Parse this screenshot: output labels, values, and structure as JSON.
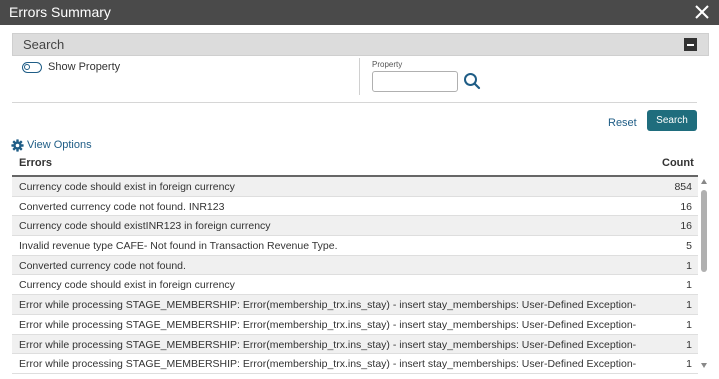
{
  "window": {
    "title": "Errors Summary"
  },
  "search_panel": {
    "label": "Search"
  },
  "filters": {
    "toggle_label": "Show Property",
    "property_label": "Property",
    "property_value": ""
  },
  "actions": {
    "reset_label": "Reset",
    "search_label": "Search"
  },
  "view_options": {
    "label": "View Options"
  },
  "table": {
    "headers": {
      "errors": "Errors",
      "count": "Count"
    },
    "rows": [
      {
        "error": "Currency code should exist          in foreign currency",
        "count": "854"
      },
      {
        "error": "Converted currency code not found. INR123",
        "count": "16"
      },
      {
        "error": "Currency code should existINR123 in foreign currency",
        "count": "16"
      },
      {
        "error": "Invalid revenue type CAFE- Not found in Transaction Revenue Type.",
        "count": "5"
      },
      {
        "error": "Converted currency code not found.",
        "count": "1"
      },
      {
        "error": "Currency code should exist                 in foreign currency",
        "count": "1"
      },
      {
        "error": "Error while processing STAGE_MEMBERSHIP: Error(membership_trx.ins_stay) - insert stay_memberships: User-Defined Exception-",
        "count": "1"
      },
      {
        "error": "Error while processing STAGE_MEMBERSHIP: Error(membership_trx.ins_stay) - insert stay_memberships: User-Defined Exception-",
        "count": "1"
      },
      {
        "error": "Error while processing STAGE_MEMBERSHIP: Error(membership_trx.ins_stay) - insert stay_memberships: User-Defined Exception-",
        "count": "1"
      },
      {
        "error": "Error while processing STAGE_MEMBERSHIP: Error(membership_trx.ins_stay) - insert stay_memberships: User-Defined Exception-",
        "count": "1"
      }
    ]
  },
  "colors": {
    "titlebar": "#4a4a4a",
    "accent": "#1f5d86",
    "search_button": "#1f6d7d"
  },
  "icons": {
    "close": "close-icon",
    "collapse": "collapse-icon",
    "search": "search-icon",
    "gear": "gear-icon"
  }
}
